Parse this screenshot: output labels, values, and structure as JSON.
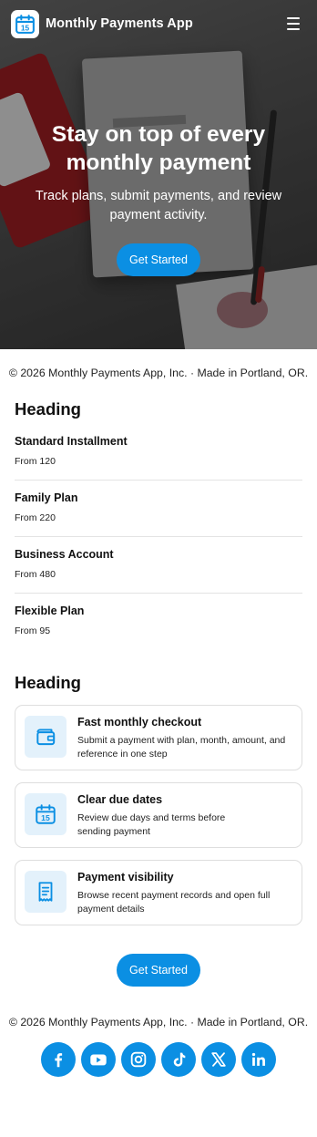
{
  "header": {
    "app_title": "Monthly Payments App",
    "logo_day": "15"
  },
  "hero": {
    "title": "Stay on top of every monthly payment",
    "subtitle": "Track plans, submit payments, and review payment activity.",
    "cta_label": "Get Started"
  },
  "footer_copyright": "© 2026 Monthly Payments App, Inc. · Made in Portland, OR.",
  "plans_section": {
    "heading": "Heading",
    "plans": [
      {
        "name": "Standard Installment",
        "price": "From 120"
      },
      {
        "name": "Family Plan",
        "price": "From 220"
      },
      {
        "name": "Business Account",
        "price": "From 480"
      },
      {
        "name": "Flexible Plan",
        "price": "From 95"
      }
    ]
  },
  "features_section": {
    "heading": "Heading",
    "features": [
      {
        "icon": "wallet-icon",
        "title": "Fast monthly checkout",
        "description": "Submit a payment with plan, month, amount, and reference in one step"
      },
      {
        "icon": "calendar-icon",
        "title": "Clear due dates",
        "description": "Review due days and terms before sending payment"
      },
      {
        "icon": "receipt-icon",
        "title": "Payment visibility",
        "description": "Browse recent payment records and open full payment details"
      }
    ],
    "cta_label": "Get Started",
    "calendar_day": "15"
  },
  "social_links": [
    {
      "icon": "facebook-icon"
    },
    {
      "icon": "youtube-icon"
    },
    {
      "icon": "instagram-icon"
    },
    {
      "icon": "tiktok-icon"
    },
    {
      "icon": "x-icon"
    },
    {
      "icon": "linkedin-icon"
    }
  ],
  "colors": {
    "accent": "#0b8fe3",
    "icon_tile": "#e3f1fb"
  }
}
